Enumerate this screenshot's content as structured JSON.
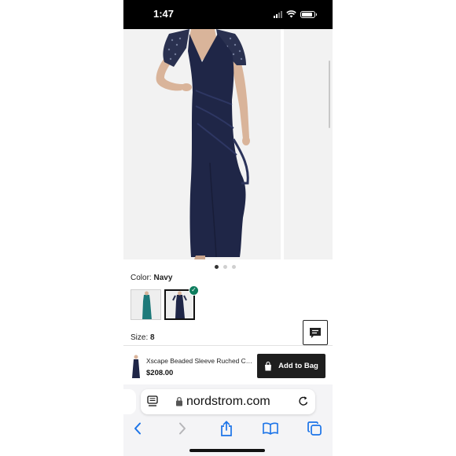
{
  "status_bar": {
    "time": "1:47",
    "battery_level": 0.85
  },
  "gallery": {
    "image_count": 3,
    "active_index": 0
  },
  "product": {
    "color_label": "Color:",
    "color_value": "Navy",
    "size_label": "Size:",
    "size_value": "8",
    "swatches": [
      {
        "name": "Teal",
        "color": "#1e7a7a",
        "selected": false
      },
      {
        "name": "Navy",
        "color": "#1c2444",
        "selected": true
      }
    ]
  },
  "bag_bar": {
    "name": "Xscape Beaded Sleeve Ruched Column Gown",
    "price": "$208.00",
    "button_label": "Add to Bag"
  },
  "browser": {
    "url": "nordstrom.com"
  },
  "colors": {
    "dress_navy": "#1f2647",
    "dress_teal": "#1e7a7a",
    "check_green": "#0e7d5e",
    "safari_blue": "#1a73e8"
  }
}
